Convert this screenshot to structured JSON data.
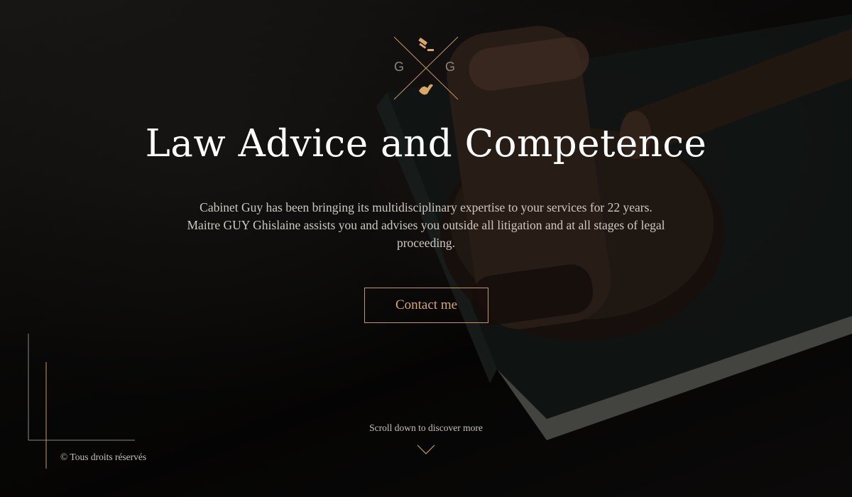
{
  "logo": {
    "left_letter": "G",
    "right_letter": "G",
    "top_icon": "gavel-icon",
    "bottom_icon": "dove-icon",
    "accent_color": "#c49a5b"
  },
  "hero": {
    "headline": "Law Advice and Competence",
    "intro": "Cabinet Guy has been bringing its multidisciplinary expertise to your services for 22 years. Maitre GUY Ghislaine assists you and advises you outside all litigation and at all stages of legal proceeding.",
    "contact_button": "Contact me",
    "scroll_hint": "Scroll down to discover more",
    "scroll_icon": "chevron-down-icon"
  },
  "footer": {
    "copyright": "© Tous droits réservés"
  },
  "colors": {
    "accent": "#c49a5b",
    "heading": "#ffffff",
    "body_text": "#cfc9c2",
    "background": "#0b0a09"
  }
}
